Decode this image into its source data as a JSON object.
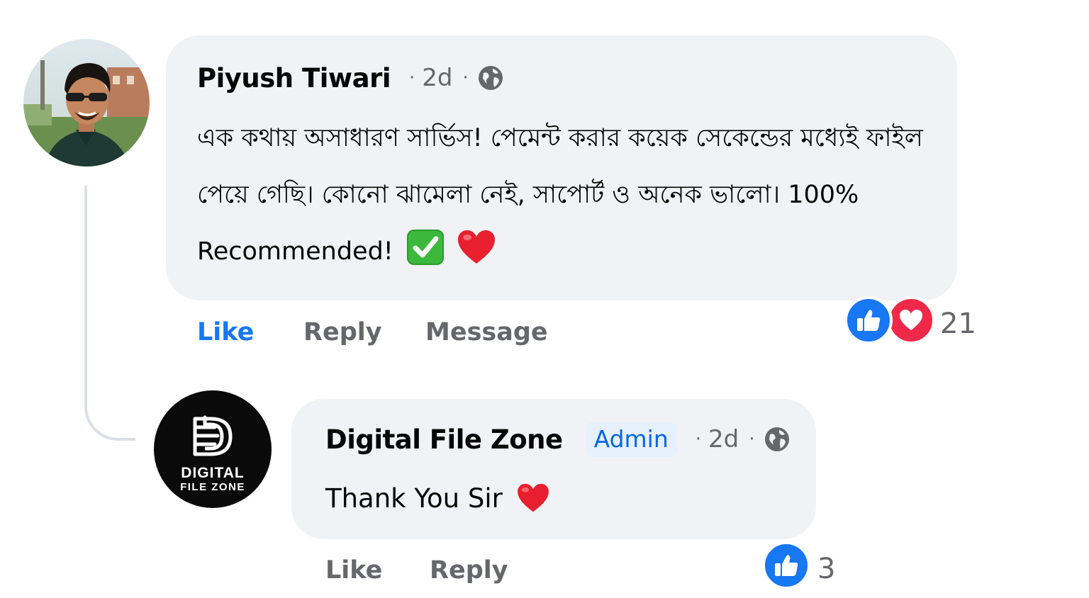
{
  "comment": {
    "author": "Piyush Tiwari",
    "separator": "·",
    "time": "2d",
    "text": "এক কথায় অসাধারণ সার্ভিস! পেমেন্ট করার কয়েক সেকেন্ডের মধ্যেই ফাইল পেয়ে গেছি। কোনো ঝামেলা নেই, সাপোর্ট ও অনেক ভালো। 100% Recommended!",
    "emojis": [
      "check-mark-icon",
      "red-heart-icon"
    ],
    "actions": {
      "like": "Like",
      "reply": "Reply",
      "message": "Message"
    },
    "like_state": "liked",
    "reactions": [
      "like",
      "love"
    ],
    "reaction_count": "21"
  },
  "reply": {
    "author": "Digital File Zone",
    "badge": "Admin",
    "separator": "·",
    "time": "2d",
    "text": "Thank You Sir",
    "emojis": [
      "red-heart-icon"
    ],
    "actions": {
      "like": "Like",
      "reply": "Reply"
    },
    "reactions": [
      "like"
    ],
    "reaction_count": "3",
    "avatar_logo_text": [
      "DIGITAL",
      "FILE ZONE"
    ]
  },
  "colors": {
    "bubble": "#f0f2f5",
    "accent_blue": "#1877f2",
    "love_red": "#f02849",
    "muted_text": "#65676b",
    "admin_badge_bg": "#e7f0fd"
  }
}
